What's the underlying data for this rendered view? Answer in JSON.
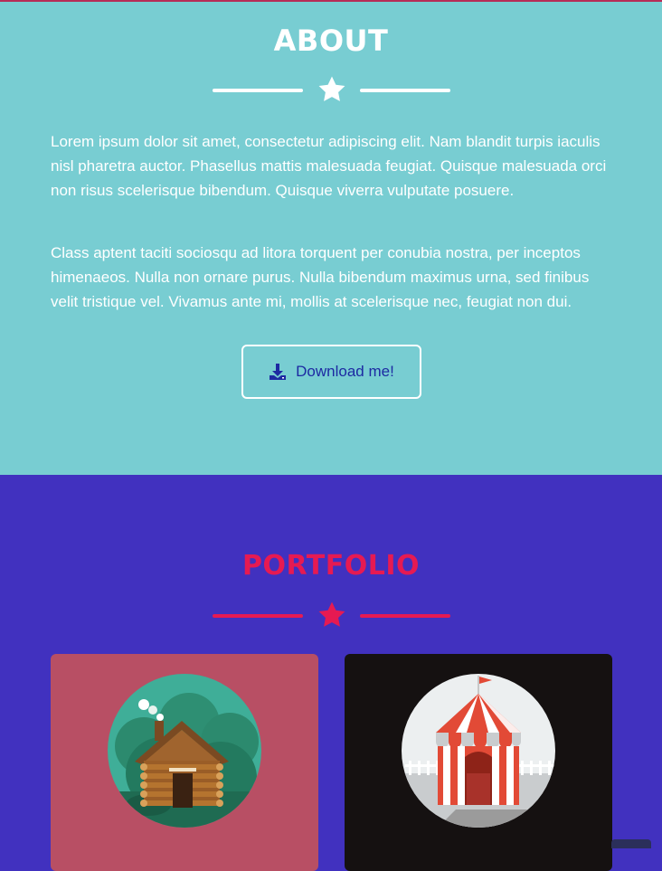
{
  "about": {
    "title": "ABOUT",
    "paragraphs": [
      "Lorem ipsum dolor sit amet, consectetur adipiscing elit. Nam blandit turpis iaculis nisl pharetra auctor. Phasellus mattis malesuada feugiat. Quisque malesuada orci non risus scelerisque bibendum. Quisque viverra vulputate posuere.",
      "Class aptent taciti sociosqu ad litora torquent per conubia nostra, per inceptos himenaeos. Nulla non ornare purus. Nulla bibendum maximus urna, sed finibus velit tristique vel. Vivamus ante mi, mollis at scelerisque nec, feugiat non dui."
    ],
    "download_label": "Download me!",
    "download_icon": "download-icon",
    "divider_icon": "star-icon"
  },
  "portfolio": {
    "title": "PORTFOLIO",
    "divider_icon": "star-icon",
    "items": [
      {
        "icon": "log-cabin-icon"
      },
      {
        "icon": "circus-tent-icon"
      }
    ]
  },
  "colors": {
    "about_bg": "#78cdd2",
    "portfolio_bg": "#4131bf",
    "accent": "#e61a52",
    "button_text": "#1d2aa2",
    "card1_bg": "#b84f64",
    "card2_bg": "#151111"
  }
}
